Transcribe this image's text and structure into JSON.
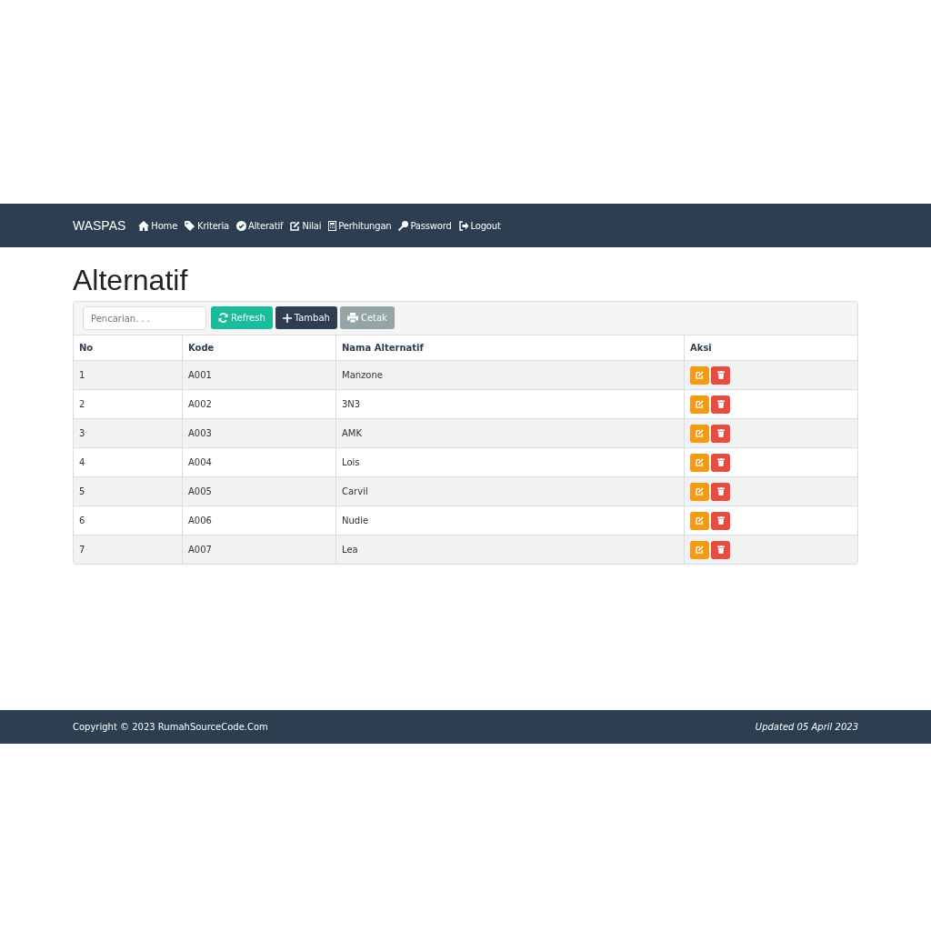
{
  "navbar": {
    "brand": "WASPAS",
    "items": [
      {
        "label": "Home",
        "kind": "home"
      },
      {
        "label": "Kriteria",
        "kind": "tags"
      },
      {
        "label": "Alteratif",
        "kind": "check"
      },
      {
        "label": "Nilai",
        "kind": "edit"
      },
      {
        "label": "Perhitungan",
        "kind": "calc"
      },
      {
        "label": "Password",
        "kind": "key"
      },
      {
        "label": "Logout",
        "kind": "logout"
      }
    ]
  },
  "page_title": "Alternatif",
  "toolbar": {
    "search": {
      "placeholder": "Pencarian. . ."
    },
    "buttons": [
      {
        "label": "Refresh",
        "kind": "refresh"
      },
      {
        "label": "Tambah",
        "kind": "add"
      },
      {
        "label": "Cetak",
        "kind": "print"
      }
    ]
  },
  "table": {
    "columns": [
      "No",
      "Kode",
      "Nama Alternatif",
      "Aksi"
    ],
    "rows": [
      [
        "1",
        "A001",
        "Manzone"
      ],
      [
        "2",
        "A002",
        "3N3"
      ],
      [
        "3",
        "A003",
        "AMK"
      ],
      [
        "4",
        "A004",
        "Lois"
      ],
      [
        "5",
        "A005",
        "Carvil"
      ],
      [
        "6",
        "A006",
        "Nudie"
      ],
      [
        "7",
        "A007",
        "Lea"
      ]
    ]
  },
  "footer": {
    "copyright": "Copyright © 2023 RumahSourceCode.Com",
    "updated": "Updated 05 April 2023"
  }
}
